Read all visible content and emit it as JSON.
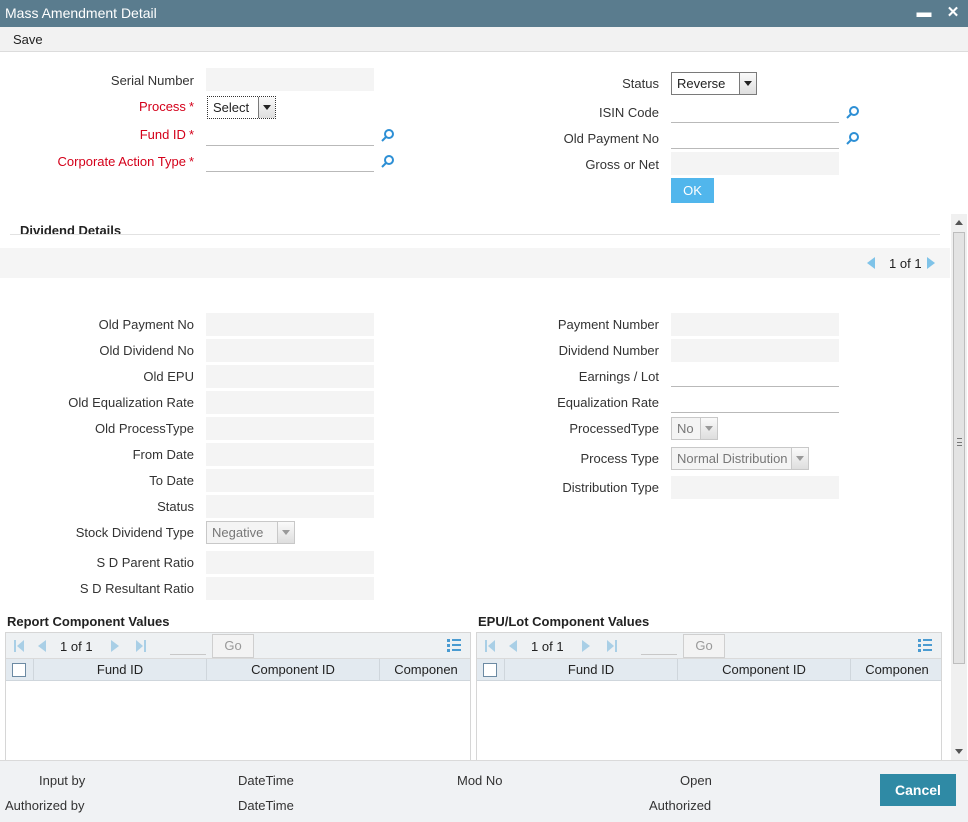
{
  "window": {
    "title": "Mass Amendment Detail",
    "minimize_glyph": "▬",
    "close_glyph": "✕"
  },
  "menu": {
    "save_label": "Save"
  },
  "header_fields": {
    "serial_number": {
      "label": "Serial Number",
      "value": ""
    },
    "process": {
      "label": "Process",
      "value": "Select"
    },
    "fund_id": {
      "label": "Fund ID",
      "value": ""
    },
    "corporate_action_type": {
      "label": "Corporate Action Type",
      "value": ""
    },
    "status": {
      "label": "Status",
      "value": "Reverse"
    },
    "isin_code": {
      "label": "ISIN Code",
      "value": ""
    },
    "old_payment_no": {
      "label": "Old Payment No",
      "value": ""
    },
    "gross_or_net": {
      "label": "Gross or Net",
      "value": ""
    },
    "required_marker": "*",
    "ok_label": "OK"
  },
  "dividend": {
    "section_title": "Dividend Details",
    "pager": {
      "current": "1",
      "of": "of",
      "total": "1"
    },
    "left": {
      "old_payment_no": "Old Payment No",
      "old_dividend_no": "Old Dividend No",
      "old_epu": "Old EPU",
      "old_equalization_rate": "Old Equalization Rate",
      "old_process_type": "Old ProcessType",
      "from_date": "From Date",
      "to_date": "To Date",
      "status": "Status",
      "stock_dividend_type": "Stock Dividend Type",
      "stock_dividend_type_value": "Negative",
      "sd_parent_ratio": "S D Parent Ratio",
      "sd_resultant_ratio": "S D Resultant Ratio"
    },
    "right": {
      "payment_number": "Payment Number",
      "dividend_number": "Dividend Number",
      "earnings_lot": "Earnings / Lot",
      "equalization_rate": "Equalization Rate",
      "processed_type": "ProcessedType",
      "processed_type_value": "No",
      "process_type": "Process Type",
      "process_type_value": "Normal Distribution",
      "distribution_type": "Distribution Type"
    }
  },
  "report_grid": {
    "title": "Report Component Values",
    "page": "1",
    "of": "of",
    "total": "1",
    "go": "Go",
    "columns": [
      "Fund ID",
      "Component ID",
      "Componen"
    ]
  },
  "epu_grid": {
    "title": "EPU/Lot Component Values",
    "page": "1",
    "of": "of",
    "total": "1",
    "go": "Go",
    "columns": [
      "Fund ID",
      "Component ID",
      "Componen"
    ]
  },
  "footer": {
    "input_by": "Input by",
    "authorized_by": "Authorized by",
    "datetime1": "DateTime",
    "datetime2": "DateTime",
    "mod_no": "Mod No",
    "open": "Open",
    "authorized": "Authorized",
    "cancel_label": "Cancel"
  },
  "colors": {
    "titlebar": "#5a7c8e",
    "required": "#d4001a",
    "accent": "#51b6ec",
    "cancel": "#2f8aa5"
  }
}
